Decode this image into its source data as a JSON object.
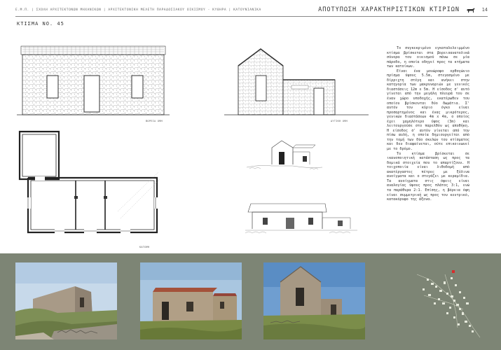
{
  "header": {
    "left_text": "Ε.Μ.Π. | ΣΧΟΛΗ ΑΡΧΙΤΕΚΤΟΝΩΝ ΜΗΧΑΝΙΚΩΝ | ΑΡΧΙΤΕΚΤΟΝΙΚΗ ΜΕΛΕΤΗ ΠΑΡΑΔΟΣΙΑΚΟΥ ΟΙΚΙΣΜΟΥ - ΚΥΘΗΡΑ | ΚΑΤΟΥΝΙΑΝΙΚΑ",
    "section_title": "ΑΠΟΤΥΠΩΣΗ ΧΑΡΑΚΤΗΡΙΣΤΙΚΩΝ ΚΤΙΡΙΩΝ",
    "page_number": "14",
    "logo_icon": "goat-icon"
  },
  "building_title": "ΚΤΙΣΜΑ ΝΟ. 45",
  "drawing_labels": {
    "north_facade": "ΒΟΡΕΙΑ ΟΨΗ",
    "west_facade": "ΔΥΤΙΚΗ ΟΨΗ",
    "plan": "ΚΑΤΟΨΗ"
  },
  "description": [
    "Το συγκεκριμένο εγκαταλελειμμένο κτίσμα βρίσκεται στα βορειοανατολικά σύνορα του οικισμού πάνω σε μία πάροδο, η οποία οδηγεί προς τα κτήματα των κατοίκων.",
    "Είναι ένα μονώροφο ορθογώνιο πρίσμα ύψους 5.5m, στεγασμένο με δίρριχτη στέγη και ανήκει στην κατηγορία των μακρυναριών με γενικές διαστάσεις 12m x 5m. Η είσοδος σ' αυτό γίνεται από την μεγάλη πλευρά του σε έναν χώρο υποδοχής, εκατέρωθεν του οποίου βρίσκονται δύο δωμάτια. Σ' αυτόν τον κύριο όγκο είναι προσαρτημένος και ένας μικρότερος, γενικών διαστάσεων 4m x 4m, ο οποίος έχει χαμηλότερο ύψος (3m) και λειτουργούσε στο παρελθόν ως αποθήκη. Η είσοδος σ' αυτόν γίνεται από την πίσω αυλή, η οποία δημιουργείται από την τομή των δύο σκελών του κτίσματος και δεν διαφαίνεται, ούτε επικοινωνεί με το δρόμο.",
    "Το κτίσμα βρίσκεται σε ικανοποιητική κατάσταση ως προς τα δομικά στοιχεία που το απαρτίζουν. Η τοιχοποιία είναι λιθοδομή από ακατέργαστες πέτρες με ξύλινα ανοίγματα και ο στεγάζει με κεραμίδια. Τα ανοίγματα στις όψεις είναι αναλογίας ύψους προς πλάτος 3:1, ενώ τα παράθυρα 2:1. Επίσης, η βόρεια όψη είναι συμμετρική ως προς τον κεντρικό, κατακόρυφο της άξονα."
  ],
  "photos": [
    {
      "name": "photo-west-side",
      "alt": "abandoned stone building with stone wall"
    },
    {
      "name": "photo-north-facade",
      "alt": "stone building with red tile roof"
    },
    {
      "name": "photo-west-facade",
      "alt": "gable end of stone building"
    }
  ],
  "map": {
    "marker_color": "#d92b2b",
    "icon": "location-marker-icon"
  }
}
